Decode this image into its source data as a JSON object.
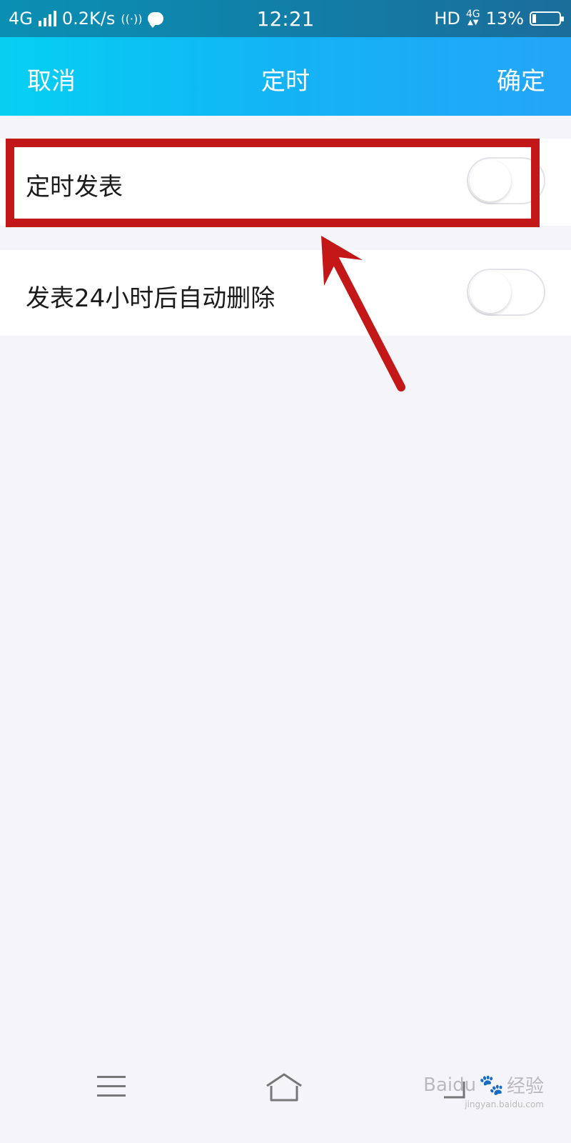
{
  "status_bar": {
    "network": "4G",
    "speed": "0.2K/s",
    "time": "12:21",
    "hd": "HD",
    "net_small": "4G",
    "battery": "13%",
    "battery_level": 0.13
  },
  "nav": {
    "cancel": "取消",
    "title": "定时",
    "confirm": "确定"
  },
  "settings": [
    {
      "label": "定时发表",
      "enabled": false
    },
    {
      "label": "发表24小时后自动删除",
      "enabled": false
    }
  ],
  "annotation": {
    "color": "#c41717"
  },
  "watermark": {
    "brand": "Baidu",
    "suffix": "经验",
    "url": "jingyan.baidu.com"
  },
  "colors": {
    "status_bar": "#117fa8",
    "nav_start": "#05d0f2",
    "nav_end": "#25a5f8",
    "background": "#f4f4f9"
  },
  "icons": {
    "nfc": "nfc-icon",
    "chat": "chat-icon",
    "menu": "menu-icon",
    "home": "home-icon",
    "back": "back-icon"
  }
}
